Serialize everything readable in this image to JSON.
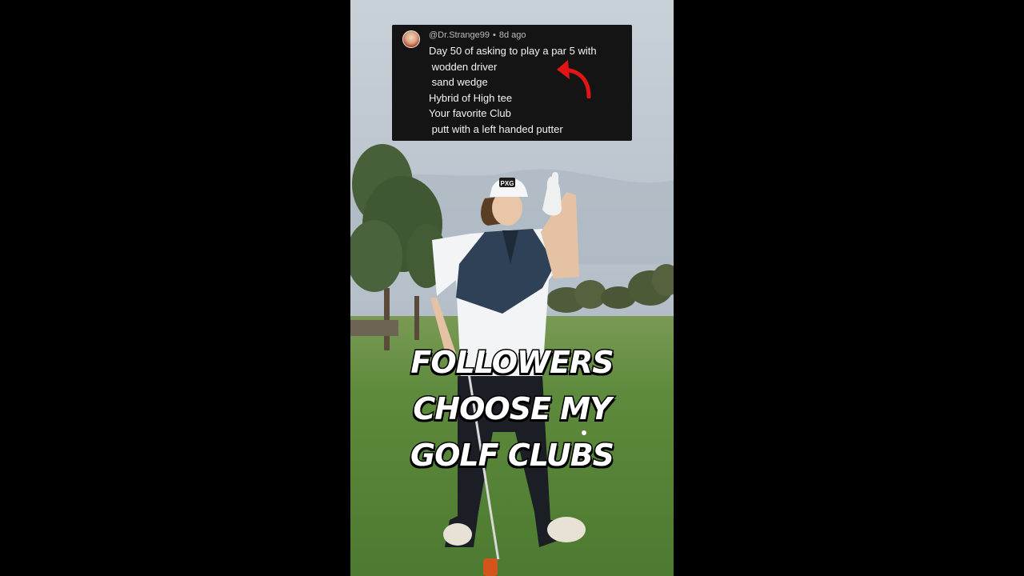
{
  "comment": {
    "username": "@Dr.Strange99",
    "separator": "•",
    "age": "8d ago",
    "lines": [
      "Day 50 of asking to play a par 5 with",
      " wodden driver",
      " sand wedge",
      "Hybrid of High tee",
      "Your favorite Club",
      " putt with a left handed putter"
    ]
  },
  "caption": {
    "line1": "FOLLOWERS",
    "line2": "CHOOSE MY",
    "line3": "GOLF CLUBS"
  },
  "cap_logo_text": "PXG",
  "colors": {
    "arrow": "#e31414",
    "card_bg": "#141414",
    "grass": "#5f8a3e",
    "sky": "#c3ccd5"
  }
}
